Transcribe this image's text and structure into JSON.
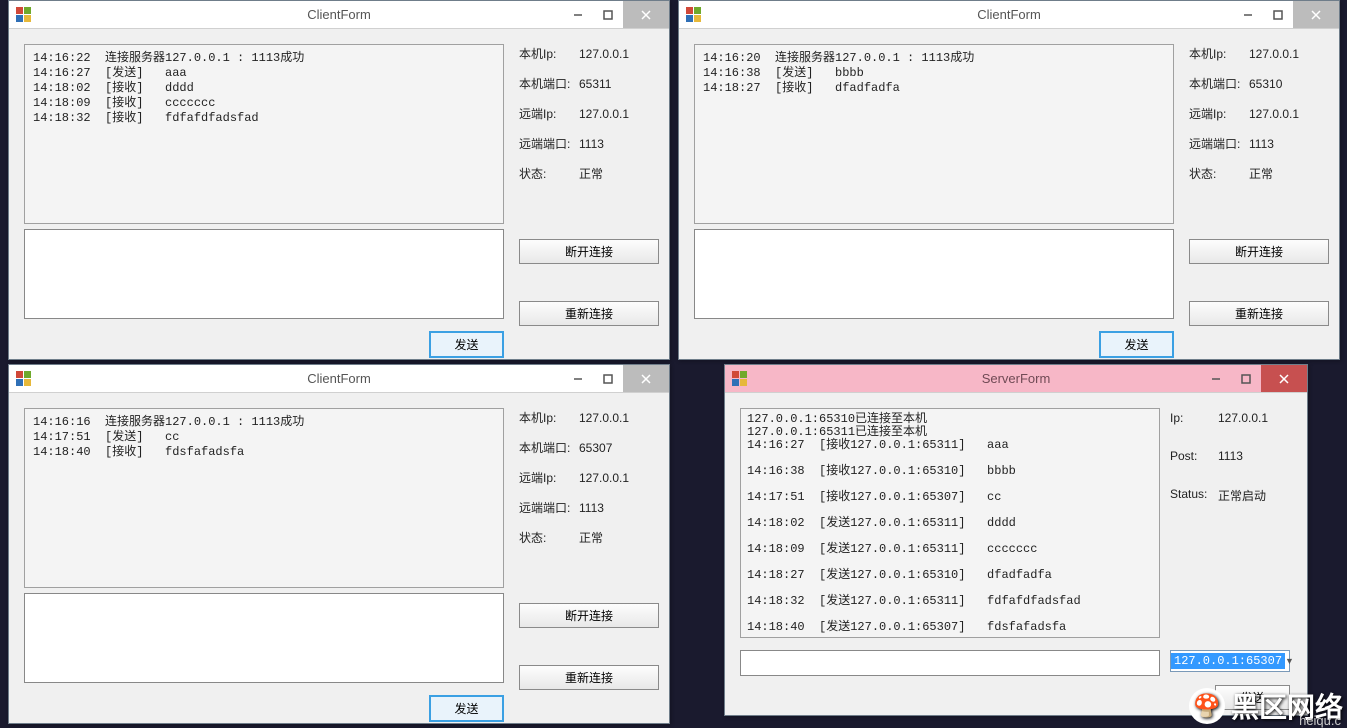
{
  "labels": {
    "local_ip": "本机Ip:",
    "local_port": "本机端口:",
    "remote_ip": "远端Ip:",
    "remote_port": "远端端口:",
    "status": "状态:",
    "disconnect": "断开连接",
    "reconnect": "重新连接",
    "send": "发送",
    "server_ip": "Ip:",
    "server_port": "Post:",
    "server_status": "Status:"
  },
  "client1": {
    "title": "ClientForm",
    "log": "14:16:22  连接服务器127.0.0.1 : 1113成功\n14:16:27  [发送]   aaa\n14:18:02  [接收]   dddd\n14:18:09  [接收]   ccccccc\n14:18:32  [接收]   fdfafdfadsfad",
    "local_ip": "127.0.0.1",
    "local_port": "65311",
    "remote_ip": "127.0.0.1",
    "remote_port": "1113",
    "status": "正常"
  },
  "client2": {
    "title": "ClientForm",
    "log": "14:16:20  连接服务器127.0.0.1 : 1113成功\n14:16:38  [发送]   bbbb\n14:18:27  [接收]   dfadfadfa",
    "local_ip": "127.0.0.1",
    "local_port": "65310",
    "remote_ip": "127.0.0.1",
    "remote_port": "1113",
    "status": "正常"
  },
  "client3": {
    "title": "ClientForm",
    "log": "14:16:16  连接服务器127.0.0.1 : 1113成功\n14:17:51  [发送]   cc\n14:18:40  [接收]   fdsfafadsfa",
    "local_ip": "127.0.0.1",
    "local_port": "65307",
    "remote_ip": "127.0.0.1",
    "remote_port": "1113",
    "status": "正常"
  },
  "server": {
    "title": "ServerForm",
    "log": "127.0.0.1:65310已连接至本机\n127.0.0.1:65311已连接至本机\n14:16:27  [接收127.0.0.1:65311]   aaa\n\n14:16:38  [接收127.0.0.1:65310]   bbbb\n\n14:17:51  [接收127.0.0.1:65307]   cc\n\n14:18:02  [发送127.0.0.1:65311]   dddd\n\n14:18:09  [发送127.0.0.1:65311]   ccccccc\n\n14:18:27  [发送127.0.0.1:65310]   dfadfadfa\n\n14:18:32  [发送127.0.0.1:65311]   fdfafdfadsfad\n\n14:18:40  [发送127.0.0.1:65307]   fdsfafadsfa",
    "ip": "127.0.0.1",
    "port": "1113",
    "status": "正常启动",
    "combo_selected": "127.0.0.1:65307"
  },
  "watermark": "黑区网络",
  "watermark_url": "heiqu.c"
}
